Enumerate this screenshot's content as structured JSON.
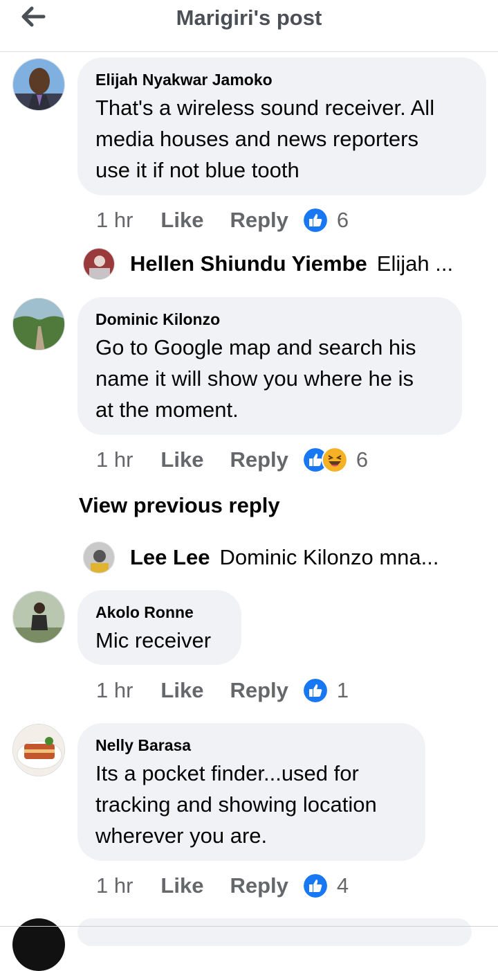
{
  "header": {
    "title": "Marigiri's post",
    "back_icon": "arrow-left-icon"
  },
  "comments": [
    {
      "author": "Elijah Nyakwar Jamoko",
      "text_lines": [
        "That's a wireless sound receiver. All",
        "media houses and news reporters",
        "use it if not blue tooth"
      ],
      "time": "1 hr",
      "like_label": "Like",
      "reply_label": "Reply",
      "reactions": [
        "like"
      ],
      "reaction_count": "6",
      "reply_preview": {
        "name": "Hellen Shiundu Yiembe",
        "text": "Elijah ..."
      }
    },
    {
      "author": "Dominic Kilonzo",
      "text_lines": [
        "Go to Google map and search his",
        "name it will show you where he is",
        "at the moment."
      ],
      "time": "1 hr",
      "like_label": "Like",
      "reply_label": "Reply",
      "reactions": [
        "like",
        "haha"
      ],
      "reaction_count": "6",
      "view_previous": "View previous reply",
      "reply_preview": {
        "name": "Lee Lee",
        "text": "Dominic Kilonzo mna..."
      }
    },
    {
      "author": "Akolo Ronne",
      "text_lines": [
        "Mic receiver"
      ],
      "time": "1 hr",
      "like_label": "Like",
      "reply_label": "Reply",
      "reactions": [
        "like"
      ],
      "reaction_count": "1"
    },
    {
      "author": "Nelly Barasa",
      "text_lines": [
        "Its a pocket finder...used for",
        "tracking and showing location",
        "wherever you are."
      ],
      "time": "1 hr",
      "like_label": "Like",
      "reply_label": "Reply",
      "reactions": [
        "like"
      ],
      "reaction_count": "4"
    }
  ],
  "colors": {
    "bubble": "#f0f2f5",
    "meta": "#65676b",
    "like_blue": "#1877f2",
    "haha_yellow": "#f7b125"
  }
}
